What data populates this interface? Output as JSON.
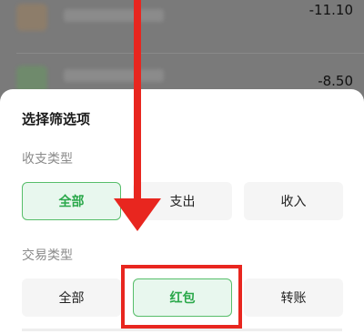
{
  "background": {
    "rows": [
      {
        "amount": "-11.10"
      },
      {
        "amount": "-8.50"
      }
    ]
  },
  "sheet": {
    "title": "选择筛选项",
    "sections": [
      {
        "label": "收支类型",
        "options": [
          {
            "label": "全部",
            "selected": true
          },
          {
            "label": "支出",
            "selected": false
          },
          {
            "label": "收入",
            "selected": false
          }
        ]
      },
      {
        "label": "交易类型",
        "options": [
          {
            "label": "全部",
            "selected": false
          },
          {
            "label": "红包",
            "selected": true
          },
          {
            "label": "转账",
            "selected": false
          }
        ]
      }
    ]
  },
  "colors": {
    "accent_green": "#2aa84a",
    "annotation_red": "#e8261f"
  }
}
